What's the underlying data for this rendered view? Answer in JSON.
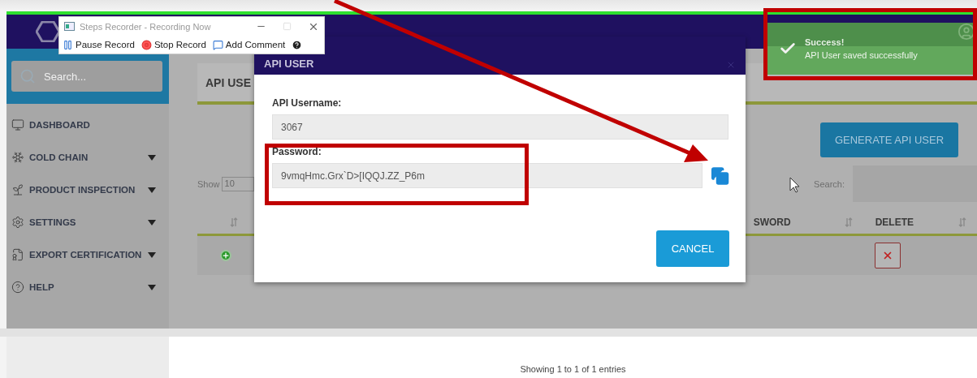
{
  "sidebar": {
    "search": {
      "placeholder": "Search..."
    },
    "items": [
      {
        "label": "DASHBOARD",
        "expandable": false
      },
      {
        "label": "COLD CHAIN",
        "expandable": true
      },
      {
        "label": "PRODUCT INSPECTION",
        "expandable": true
      },
      {
        "label": "SETTINGS",
        "expandable": true
      },
      {
        "label": "EXPORT CERTIFICATION",
        "expandable": true
      },
      {
        "label": "HELP",
        "expandable": true
      }
    ]
  },
  "page": {
    "title": "API USE",
    "generate_button": "GENERATE API USER",
    "show_label": "Show",
    "page_size": "10",
    "search_label": "Search:",
    "columns": [
      {
        "label": "SWORD"
      },
      {
        "label": "DELETE"
      }
    ],
    "footer": "Showing 1 to 1 of 1 entries"
  },
  "modal": {
    "title": "API USER",
    "fields": [
      {
        "label": "API Username:",
        "value": "3067",
        "copy": false
      },
      {
        "label": "Password:",
        "value": "9vmqHmc.Grx`D>[IQQJ.ZZ_P6m",
        "copy": true
      }
    ],
    "cancel": "CANCEL"
  },
  "recorder": {
    "title": "Steps Recorder - Recording Now",
    "buttons": [
      {
        "label": "Pause Record"
      },
      {
        "label": "Stop Record"
      },
      {
        "label": "Add Comment"
      }
    ]
  },
  "toast": {
    "title": "Success!",
    "message": "API User saved successfully"
  }
}
